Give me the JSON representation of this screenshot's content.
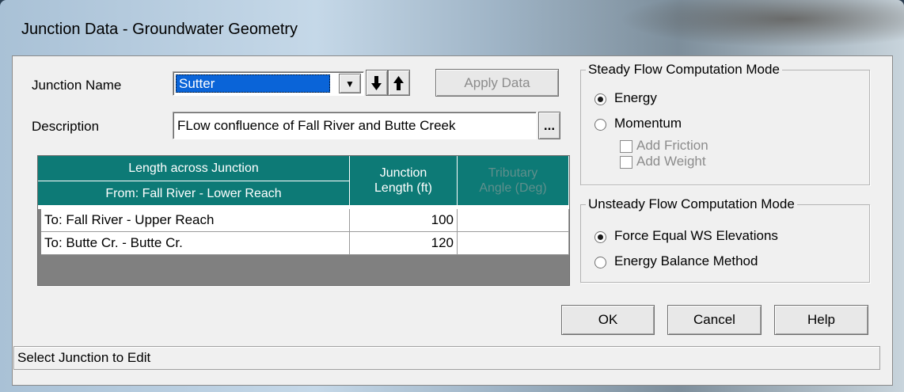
{
  "window": {
    "title": "Junction Data - Groundwater Geometry"
  },
  "form": {
    "junction_name_label": "Junction Name",
    "junction_name_value": "Sutter",
    "down_icon": "arrow-down",
    "up_icon": "arrow-up",
    "apply_label": "Apply Data",
    "description_label": "Description",
    "description_value": "FLow confluence of Fall River and Butte Creek",
    "browse_label": "..."
  },
  "table": {
    "header_length": "Length across Junction",
    "header_from": "From: Fall River - Lower Reach",
    "header_junction_line1": "Junction",
    "header_junction_line2": "Length (ft)",
    "header_angle_line1": "Tributary",
    "header_angle_line2": "Angle (Deg)",
    "rows": [
      {
        "to": "To: Fall River - Upper Reach",
        "length": "100",
        "angle": ""
      },
      {
        "to": "To: Butte Cr. - Butte Cr.",
        "length": "120",
        "angle": ""
      }
    ]
  },
  "steady": {
    "title": "Steady Flow Computation Mode",
    "energy_label": "Energy",
    "momentum_label": "Momentum",
    "add_friction_label": "Add Friction",
    "add_weight_label": "Add Weight",
    "selected": "Energy"
  },
  "unsteady": {
    "title": "Unsteady Flow Computation Mode",
    "force_label": "Force Equal WS Elevations",
    "energy_balance_label": "Energy Balance Method",
    "selected": "Force Equal WS Elevations"
  },
  "buttons": {
    "ok": "OK",
    "cancel": "Cancel",
    "help": "Help"
  },
  "status": {
    "text": "Select Junction to Edit"
  }
}
